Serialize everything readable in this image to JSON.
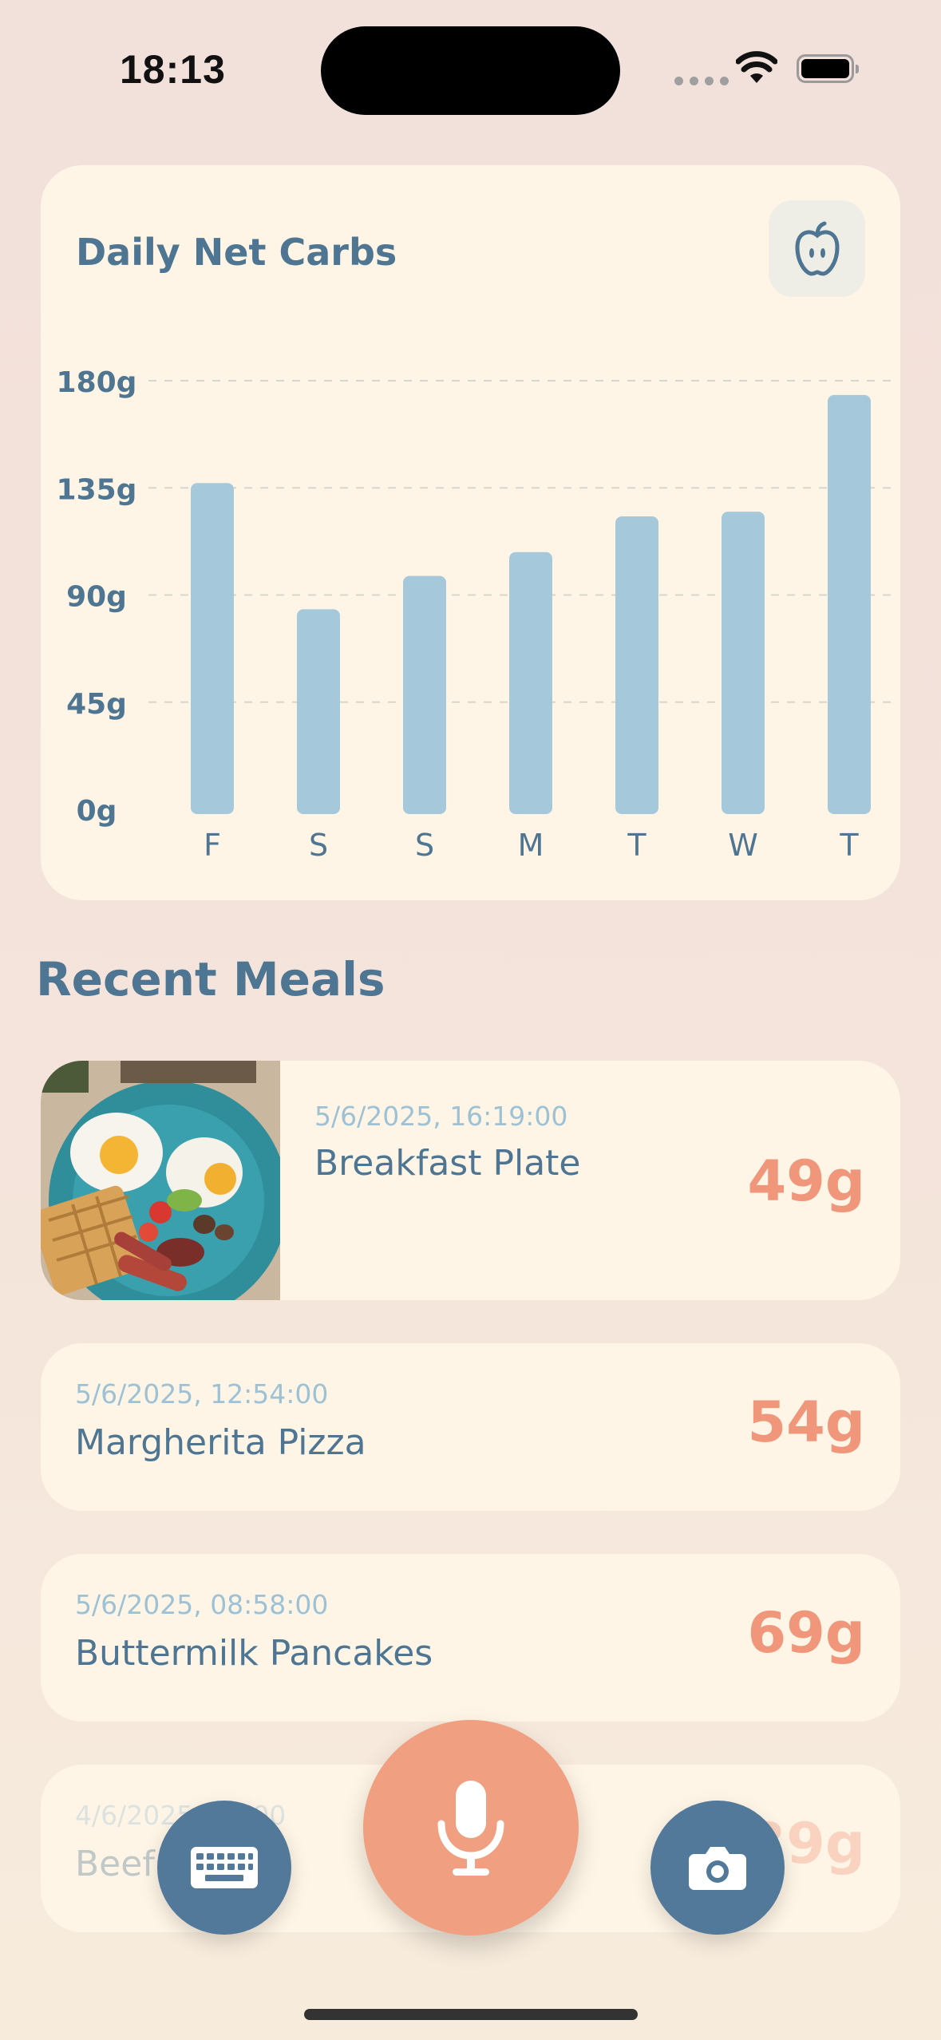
{
  "status_bar": {
    "time": "18:13"
  },
  "chart_card": {
    "title": "Daily Net Carbs",
    "icon": "apple-icon"
  },
  "chart_data": {
    "type": "bar",
    "categories": [
      "F",
      "S",
      "S",
      "M",
      "T",
      "W",
      "T"
    ],
    "values": [
      137,
      84,
      98,
      108,
      123,
      125,
      174
    ],
    "ylim": [
      0,
      180
    ],
    "y_ticks": [
      "0g",
      "45g",
      "90g",
      "135g",
      "180g"
    ],
    "grid": true,
    "bar_color": "#a5c9da"
  },
  "recent_meals": {
    "title": "Recent Meals",
    "items": [
      {
        "time": "5/6/2025, 16:19:00",
        "name": "Breakfast Plate",
        "carbs": "49g",
        "has_photo": true
      },
      {
        "time": "5/6/2025, 12:54:00",
        "name": "Margherita Pizza",
        "carbs": "54g"
      },
      {
        "time": "5/6/2025, 08:58:00",
        "name": "Buttermilk Pancakes",
        "carbs": "69g"
      },
      {
        "time": "4/6/2025, 17:00",
        "name": "Beef",
        "carbs": "39g"
      }
    ]
  },
  "actions": {
    "keyboard_icon": "keyboard-icon",
    "mic_icon": "microphone-icon",
    "camera_icon": "camera-icon"
  },
  "colors": {
    "accent": "#f0a080",
    "primary": "#52789a",
    "card": "#fef5e6"
  }
}
